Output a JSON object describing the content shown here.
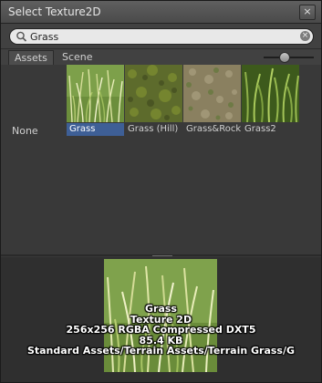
{
  "window": {
    "title": "Select Texture2D",
    "close_glyph": "×"
  },
  "search": {
    "value": "Grass",
    "placeholder": "",
    "clear_glyph": "×"
  },
  "tabs": [
    {
      "label": "Assets",
      "active": true
    },
    {
      "label": "Scene",
      "active": false
    }
  ],
  "zoom_slider": {
    "level": 0.35
  },
  "grid": {
    "none_label": "None",
    "items": [
      {
        "label": "Grass",
        "selected": true
      },
      {
        "label": "Grass (Hill)",
        "selected": false
      },
      {
        "label": "Grass&Rock",
        "selected": false
      },
      {
        "label": "Grass2",
        "selected": false
      }
    ]
  },
  "preview": {
    "name": "Grass",
    "type": "Texture 2D",
    "format": "256x256  RGBA Compressed DXT5",
    "size": "85.4 KB",
    "path": "Standard Assets/Terrain Assets/Terrain Grass/G"
  },
  "colors": {
    "selection": "#3e5f96",
    "background": "#383838"
  }
}
